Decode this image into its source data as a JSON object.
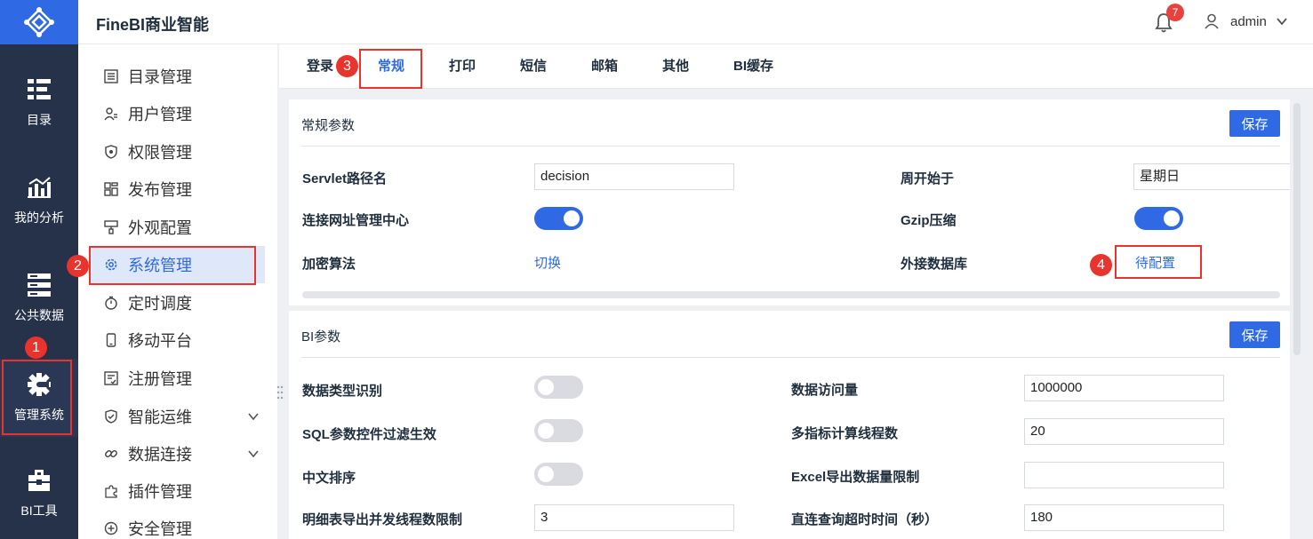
{
  "app": {
    "title": "FineBI商业智能"
  },
  "rail": {
    "items": [
      {
        "label": "目录",
        "icon": "catalog-icon"
      },
      {
        "label": "我的分析",
        "icon": "analysis-icon"
      },
      {
        "label": "公共数据",
        "icon": "public-data-icon"
      },
      {
        "label": "管理系统",
        "icon": "admin-gear-icon"
      },
      {
        "label": "BI工具",
        "icon": "toolbox-icon"
      }
    ]
  },
  "header": {
    "notification_count": "7",
    "username": "admin"
  },
  "menu": {
    "items": [
      {
        "label": "目录管理"
      },
      {
        "label": "用户管理"
      },
      {
        "label": "权限管理"
      },
      {
        "label": "发布管理"
      },
      {
        "label": "外观配置"
      },
      {
        "label": "系统管理"
      },
      {
        "label": "定时调度"
      },
      {
        "label": "移动平台"
      },
      {
        "label": "注册管理"
      },
      {
        "label": "智能运维"
      },
      {
        "label": "数据连接"
      },
      {
        "label": "插件管理"
      },
      {
        "label": "安全管理"
      }
    ]
  },
  "tabs": [
    "登录",
    "常规",
    "打印",
    "短信",
    "邮箱",
    "其他",
    "BI缓存"
  ],
  "general": {
    "title": "常规参数",
    "save": "保存",
    "servlet_label": "Servlet路径名",
    "servlet_value": "decision",
    "week_label": "周开始于",
    "week_value": "星期日",
    "connect_label": "连接网址管理中心",
    "gzip_label": "Gzip压缩",
    "encrypt_label": "加密算法",
    "encrypt_link": "切换",
    "external_db_label": "外接数据库",
    "external_db_link": "待配置"
  },
  "bi": {
    "title": "BI参数",
    "save": "保存",
    "type_detect_label": "数据类型识别",
    "sql_filter_label": "SQL参数控件过滤生效",
    "chinese_sort_label": "中文排序",
    "detail_export_label": "明细表导出并发线程数限制",
    "detail_export_value": "3",
    "access_label": "数据访问量",
    "access_value": "1000000",
    "threads_label": "多指标计算线程数",
    "threads_value": "20",
    "excel_label": "Excel导出数据量限制",
    "excel_value": "",
    "timeout_label": "直连查询超时时间（秒）",
    "timeout_value": "180"
  },
  "annotations": [
    "1",
    "2",
    "3",
    "4"
  ],
  "colors": {
    "accent": "#2f6ae4",
    "rail": "#26324a",
    "annotation": "#e8342c"
  }
}
